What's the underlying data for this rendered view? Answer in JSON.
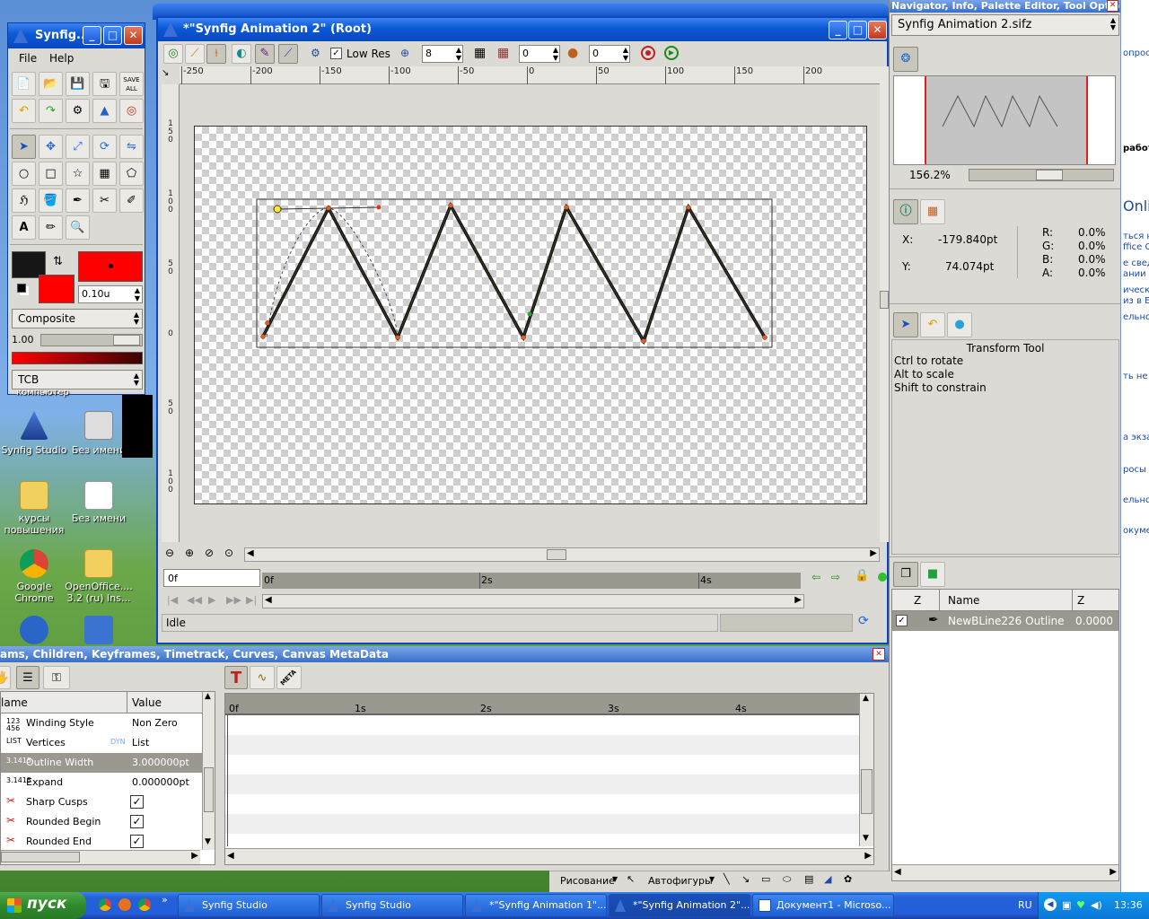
{
  "toolbox": {
    "title": "Synfig...",
    "menu": [
      "File",
      "Help"
    ],
    "file_buttons_extra": "SAVE ALL",
    "width_value": "0.10u",
    "blend_method": "Composite",
    "opacity": "1.00",
    "interpolation": "TCB",
    "outline_color": "#161616",
    "fill_color": "#ff0000"
  },
  "canvas_window": {
    "title": "*\"Synfig Animation 2\" (Root)",
    "lowres_label": "Low Res",
    "quality": "8",
    "onion_past": "0",
    "onion_future": "0",
    "ruler_top": [
      "-250",
      "-200",
      "-150",
      "-100",
      "-50",
      "0",
      "50",
      "100",
      "150",
      "200"
    ],
    "ruler_left": [
      "150",
      "100",
      "50",
      "0",
      "50",
      "100"
    ],
    "current_time": "0f",
    "time_marks": [
      "0f",
      "2s",
      "4s"
    ],
    "status": "Idle"
  },
  "params_panel": {
    "title": "ams, Children, Keyframes, Timetrack, Curves, Canvas MetaData",
    "col_name": "lame",
    "col_value": "Value",
    "rows": [
      {
        "type": "123\n456",
        "name": "Winding Style",
        "value": "Non Zero"
      },
      {
        "type": "LIST",
        "name": "Vertices",
        "value": "List",
        "extra": "DYN"
      },
      {
        "type": "3.1415",
        "name": "Outline Width",
        "value": "3.000000pt"
      },
      {
        "type": "3.1415",
        "name": "Expand",
        "value": "0.000000pt"
      },
      {
        "type": "",
        "name": "Sharp Cusps",
        "value": ""
      },
      {
        "type": "",
        "name": "Rounded Begin",
        "value": ""
      },
      {
        "type": "",
        "name": "Rounded End",
        "value": ""
      }
    ],
    "time_marks": [
      "0f",
      "1s",
      "2s",
      "3s",
      "4s"
    ],
    "meta_btn": "META"
  },
  "navigator": {
    "title": "Navigator, Info, Palette Editor, Tool Optio...",
    "file": "Synfig Animation 2.sifz",
    "zoom": "156.2%"
  },
  "info": {
    "x_label": "X:",
    "x_value": "-179.840pt",
    "y_label": "Y:",
    "y_value": "74.074pt",
    "r_label": "R:",
    "r_value": "0.0%",
    "g_label": "G:",
    "g_value": "0.0%",
    "b_label": "B:",
    "b_value": "0.0%",
    "a_label": "A:",
    "a_value": "0.0%"
  },
  "tool_options": {
    "title": "Transform Tool",
    "lines": [
      "Ctrl to rotate",
      "Alt to scale",
      "Shift to constrain"
    ]
  },
  "layers": {
    "col_z": "Z",
    "col_name": "Name",
    "col_z2": "Z",
    "row_name": "NewBLine226 Outline",
    "row_z": "0.0000"
  },
  "desktop_icons": [
    {
      "label": "Synfig Studio"
    },
    {
      "label": "Без имени"
    },
    {
      "label": "курсы повышения"
    },
    {
      "label": "Без имени"
    },
    {
      "label": "Google Chrome"
    },
    {
      "label": "OpenOffice.... 3.2 (ru) Ins..."
    }
  ],
  "desktop_misc": {
    "partial_label": "компьютер"
  },
  "word_bg": {
    "lines": [
      "опрос",
      "работ",
      "Onli",
      "ться н",
      "ffice C",
      "е свед",
      "ании V",
      "ически",
      "из в Е",
      "ельно",
      "ть не",
      "а экза",
      "росы",
      "ельно",
      "окуме"
    ],
    "drawing": "Рисование",
    "autoshapes": "Автофигуры"
  },
  "taskbar": {
    "start": "пуск",
    "items": [
      "Synfig Studio",
      "Synfig Studio",
      "*\"Synfig Animation 1\"...",
      "*\"Synfig Animation 2\"...",
      "Документ1 - Microso..."
    ],
    "lang": "RU",
    "clock": "13:36"
  }
}
